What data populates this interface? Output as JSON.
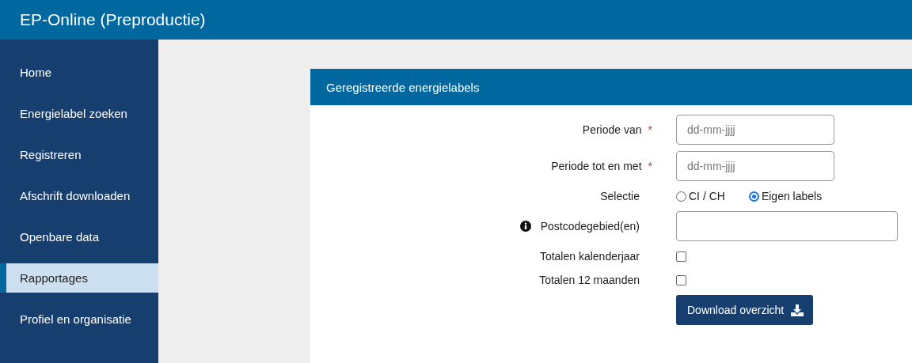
{
  "header": {
    "title": "EP-Online (Preproductie)"
  },
  "sidebar": {
    "items": [
      {
        "label": "Home",
        "selected": false
      },
      {
        "label": "Energielabel zoeken",
        "selected": false
      },
      {
        "label": "Registreren",
        "selected": false
      },
      {
        "label": "Afschrift downloaden",
        "selected": false
      },
      {
        "label": "Openbare data",
        "selected": false
      },
      {
        "label": "Rapportages",
        "selected": true
      },
      {
        "label": "Profiel en organisatie",
        "selected": false
      }
    ]
  },
  "panel": {
    "title": "Geregistreerde energielabels",
    "rows": [
      {
        "kind": "date",
        "label": "Periode van",
        "required_mark": "*",
        "placeholder": "dd-mm-jjjj"
      },
      {
        "kind": "date",
        "label": "Periode tot en met",
        "required_mark": "*",
        "placeholder": "dd-mm-jjjj"
      },
      {
        "kind": "radio",
        "label": "Selectie",
        "options": [
          {
            "label": "CI / CH",
            "selected": false
          },
          {
            "label": "Eigen labels",
            "selected": true
          }
        ]
      },
      {
        "kind": "text",
        "label": "Postcodegebied(en)",
        "info": true
      },
      {
        "kind": "checkbox",
        "label": "Totalen kalenderjaar",
        "checked": false
      },
      {
        "kind": "checkbox",
        "label": "Totalen 12 maanden",
        "checked": false
      },
      {
        "kind": "button",
        "label": "Download overzicht"
      }
    ]
  }
}
